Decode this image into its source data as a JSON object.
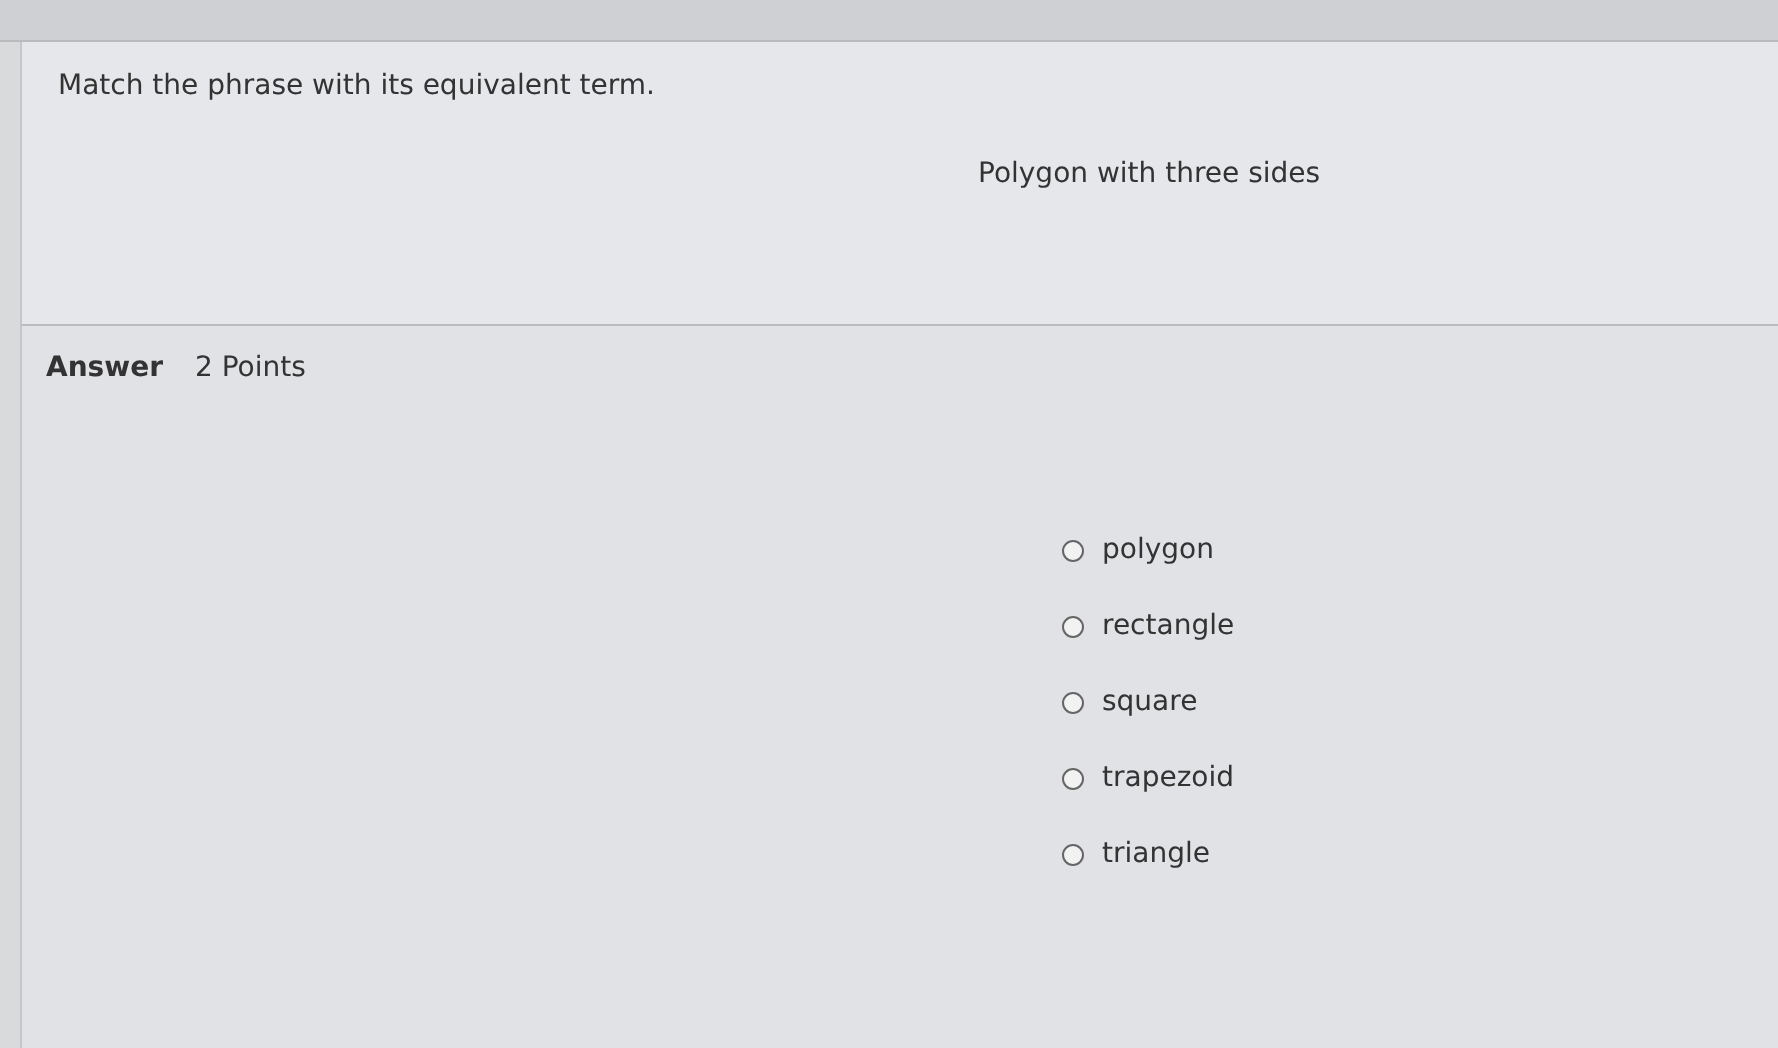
{
  "question": {
    "prompt": "Match the phrase with its equivalent term.",
    "phrase": "Polygon with three sides"
  },
  "answer": {
    "label": "Answer",
    "points": "2 Points",
    "options": [
      {
        "label": "polygon",
        "selected": false
      },
      {
        "label": "rectangle",
        "selected": false
      },
      {
        "label": "square",
        "selected": false
      },
      {
        "label": "trapezoid",
        "selected": false
      },
      {
        "label": "triangle",
        "selected": false
      }
    ]
  }
}
